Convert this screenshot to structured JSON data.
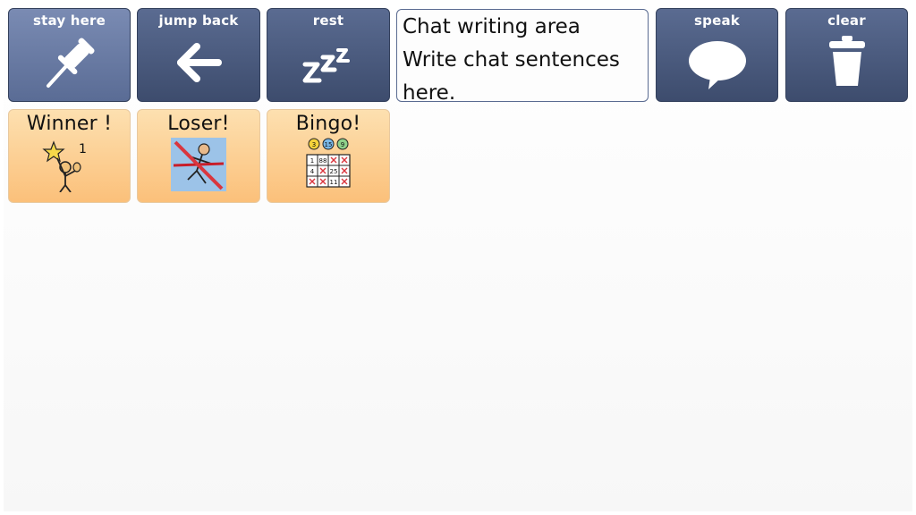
{
  "toolbar": {
    "stay_here": {
      "label": "stay here",
      "icon": "pushpin-icon"
    },
    "jump_back": {
      "label": "jump back",
      "icon": "arrow-left-icon"
    },
    "rest": {
      "label": "rest",
      "icon": "sleep-zzz-icon"
    },
    "speak": {
      "label": "speak",
      "icon": "speech-bubble-icon"
    },
    "clear": {
      "label": "clear",
      "icon": "trash-icon"
    }
  },
  "chat_area": {
    "line1": "Chat writing area",
    "line2": "Write chat sentences",
    "line3": "here."
  },
  "cells": [
    {
      "label": "Winner !",
      "icon": "winner-star-icon",
      "symbol_text": "1"
    },
    {
      "label": "Loser!",
      "icon": "loser-icon"
    },
    {
      "label": "Bingo!",
      "icon": "bingo-card-icon",
      "balls": [
        "3",
        "15",
        "9"
      ],
      "card": [
        [
          "1",
          "88",
          "",
          ""
        ],
        [
          "4",
          "",
          "25",
          ""
        ],
        [
          "",
          "",
          "11",
          ""
        ]
      ]
    }
  ],
  "colors": {
    "toolbar_dark": "#3d4c6d",
    "toolbar_active": "#6a7ba4",
    "cell_orange": "#fbc07a",
    "mark_red": "#d9363e"
  }
}
